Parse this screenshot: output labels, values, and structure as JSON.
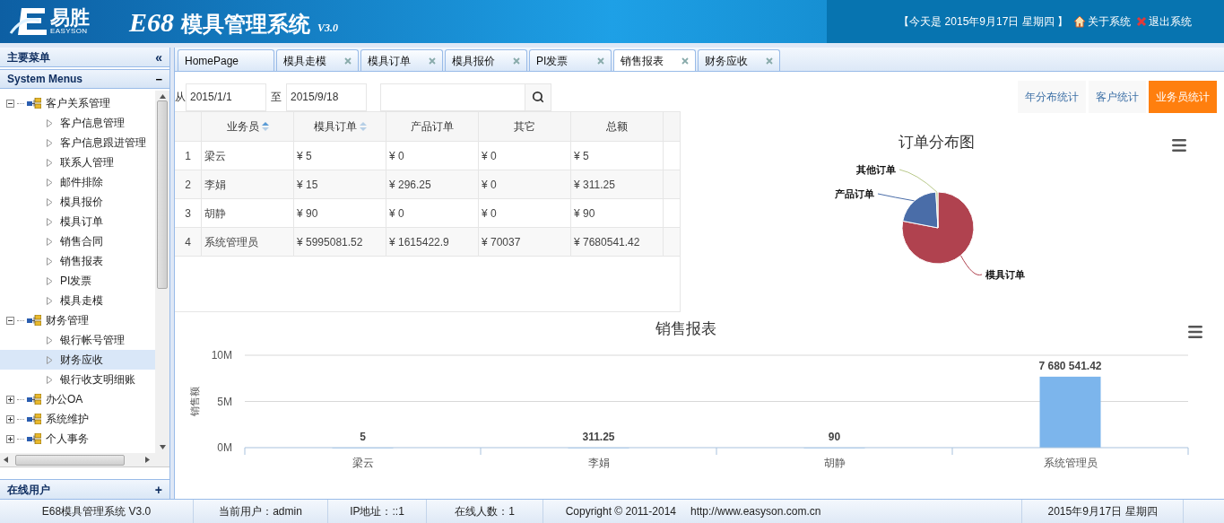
{
  "header": {
    "brand": "易胜",
    "brand_sub": "EASYSON",
    "title_code": "E68",
    "title": "模具管理系统",
    "version": "V3.0",
    "date": "【今天是 2015年9月17日 星期四 】",
    "links": [
      {
        "kind": "home",
        "label": "关于系统"
      },
      {
        "kind": "exit",
        "label": "退出系统"
      }
    ]
  },
  "sidebar": {
    "title": "主要菜单",
    "collapse": "«",
    "section": "System Menus",
    "section_toggle": "−",
    "items": [
      {
        "label": "客户关系管理",
        "expanded": true,
        "children": [
          {
            "label": "客户信息管理",
            "selected": false
          },
          {
            "label": "客户信息跟进管理",
            "selected": false
          },
          {
            "label": "联系人管理",
            "selected": false
          },
          {
            "label": "邮件排除",
            "selected": false
          },
          {
            "label": "模具报价",
            "selected": false
          },
          {
            "label": "模具订单",
            "selected": false
          },
          {
            "label": "销售合同",
            "selected": false
          },
          {
            "label": "销售报表",
            "selected": false
          },
          {
            "label": "PI发票",
            "selected": false
          },
          {
            "label": "模具走模",
            "selected": false
          }
        ]
      },
      {
        "label": "财务管理",
        "expanded": true,
        "children": [
          {
            "label": "银行帐号管理",
            "selected": false
          },
          {
            "label": "财务应收",
            "selected": true
          },
          {
            "label": "银行收支明细账",
            "selected": false
          }
        ]
      },
      {
        "label": "办公OA",
        "expanded": false
      },
      {
        "label": "系统维护",
        "expanded": false
      },
      {
        "label": "个人事务",
        "expanded": false
      }
    ],
    "footer": "在线用户",
    "footer_toggle": "+"
  },
  "tabs": [
    {
      "label": "HomePage",
      "closable": false,
      "selected": false
    },
    {
      "label": "模具走模",
      "closable": true,
      "selected": false
    },
    {
      "label": "模具订单",
      "closable": true,
      "selected": false
    },
    {
      "label": "模具报价",
      "closable": true,
      "selected": false
    },
    {
      "label": "PI发票",
      "closable": true,
      "selected": false
    },
    {
      "label": "销售报表",
      "closable": true,
      "selected": true
    },
    {
      "label": "财务应收",
      "closable": true,
      "selected": false
    }
  ],
  "filter": {
    "from_label": "从",
    "from": "2015/1/1",
    "to_label": "至",
    "to": "2015/9/18"
  },
  "view_buttons": [
    {
      "label": "年分布统计",
      "selected": false
    },
    {
      "label": "客户统计",
      "selected": false
    },
    {
      "label": "业务员统计",
      "selected": true
    }
  ],
  "table": {
    "columns": [
      {
        "label": "业务员",
        "sortable": true
      },
      {
        "label": "模具订单",
        "sortable": true
      },
      {
        "label": "产品订单",
        "sortable": false
      },
      {
        "label": "其它",
        "sortable": false
      },
      {
        "label": "总额",
        "sortable": false
      }
    ],
    "rows": [
      {
        "index": "1",
        "cells": [
          "梁云",
          "¥ 5",
          "¥ 0",
          "¥ 0",
          "¥ 5"
        ]
      },
      {
        "index": "2",
        "cells": [
          "李娟",
          "¥ 15",
          "¥ 296.25",
          "¥ 0",
          "¥ 311.25"
        ]
      },
      {
        "index": "3",
        "cells": [
          "胡静",
          "¥ 90",
          "¥ 0",
          "¥ 0",
          "¥ 90"
        ]
      },
      {
        "index": "4",
        "cells": [
          "系统管理员",
          "¥ 5995081.52",
          "¥ 1615422.9",
          "¥ 70037",
          "¥ 7680541.42"
        ]
      }
    ]
  },
  "pie_chart": {
    "chart_data": {
      "type": "pie",
      "title": "订单分布图",
      "categories": [
        "模具订单",
        "产品订单",
        "其他订单"
      ],
      "values": [
        78.05,
        21.04,
        0.91
      ],
      "colors": [
        "#b0424f",
        "#4a6da8",
        "#b9c98b"
      ]
    }
  },
  "bar_chart": {
    "chart_data": {
      "type": "bar",
      "title": "销售报表",
      "ylabel": "销售额",
      "categories": [
        "梁云",
        "李娟",
        "胡静",
        "系统管理员"
      ],
      "values": [
        5,
        311.25,
        90,
        7680541.42
      ],
      "colors": [
        "#7cb5ec",
        "#7cb5ec",
        "#7cb5ec",
        "#7cb5ec"
      ],
      "ylim": [
        0,
        10000000
      ],
      "yticks": [
        {
          "value": 0,
          "label": "0M"
        },
        {
          "value": 5000000,
          "label": "5M"
        },
        {
          "value": 10000000,
          "label": "10M"
        }
      ],
      "value_labels": [
        "5",
        "311.25",
        "90",
        "7 680 541.42"
      ]
    }
  },
  "status_bar": [
    "E68模具管理系统 V3.0",
    "当前用户：admin",
    "IP地址：::1",
    "在线人数：1",
    "Copyright © 2011-2014",
    "http://www.easyson.com.cn",
    "2015年9月17日 星期四"
  ]
}
